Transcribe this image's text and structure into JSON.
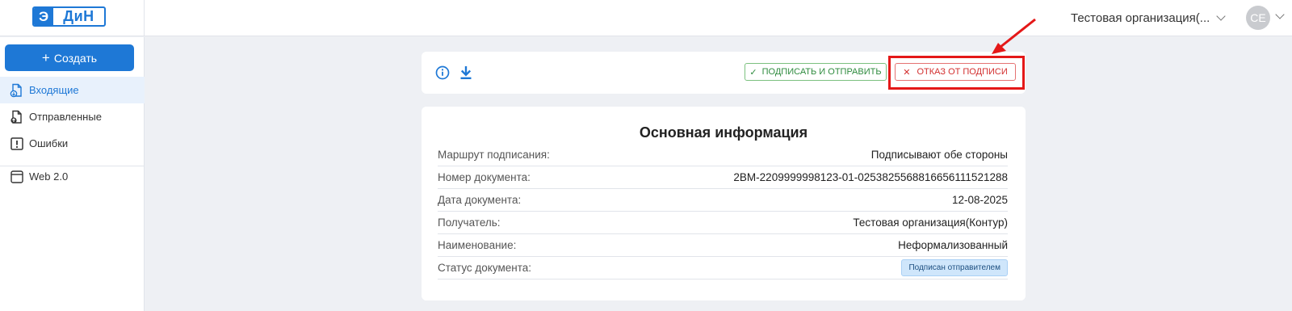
{
  "header": {
    "logo": {
      "left": "Э",
      "right": "ДиН"
    },
    "organization": "Тестовая организация(...",
    "avatar_initials": "CE"
  },
  "sidebar": {
    "create_label": "Создать",
    "create_icon": "+",
    "items": [
      {
        "label": "Входящие",
        "icon": "inbox-doc-icon",
        "active": true
      },
      {
        "label": "Отправленные",
        "icon": "sent-doc-icon",
        "active": false
      },
      {
        "label": "Ошибки",
        "icon": "error-icon",
        "active": false
      },
      {
        "label": "Web 2.0",
        "icon": "window-icon",
        "active": false
      }
    ]
  },
  "toolbar": {
    "icons": [
      "info-icon",
      "download-icon"
    ],
    "sign_label": "ПОДПИСАТЬ И ОТПРАВИТЬ",
    "sign_icon": "✓",
    "reject_label": "ОТКАЗ ОТ ПОДПИСИ",
    "reject_icon": "✕"
  },
  "info": {
    "title": "Основная информация",
    "rows": [
      {
        "label": "Маршрут подписания:",
        "value": "Подписывают обе стороны"
      },
      {
        "label": "Номер документа:",
        "value": "2BM-2209999998123-01-0253825568816656111521288"
      },
      {
        "label": "Дата документа:",
        "value": "12-08-2025"
      },
      {
        "label": "Получатель:",
        "value": "Тестовая организация(Контур)"
      },
      {
        "label": "Наименование:",
        "value": "Неформализованный"
      },
      {
        "label": "Статус документа:",
        "value": "Подписан отправителем"
      }
    ]
  },
  "colors": {
    "accent": "#1e78d6",
    "sign": "#2e8b3e",
    "reject": "#d32f2f",
    "highlight": "#e41818",
    "background": "#eef0f4"
  }
}
